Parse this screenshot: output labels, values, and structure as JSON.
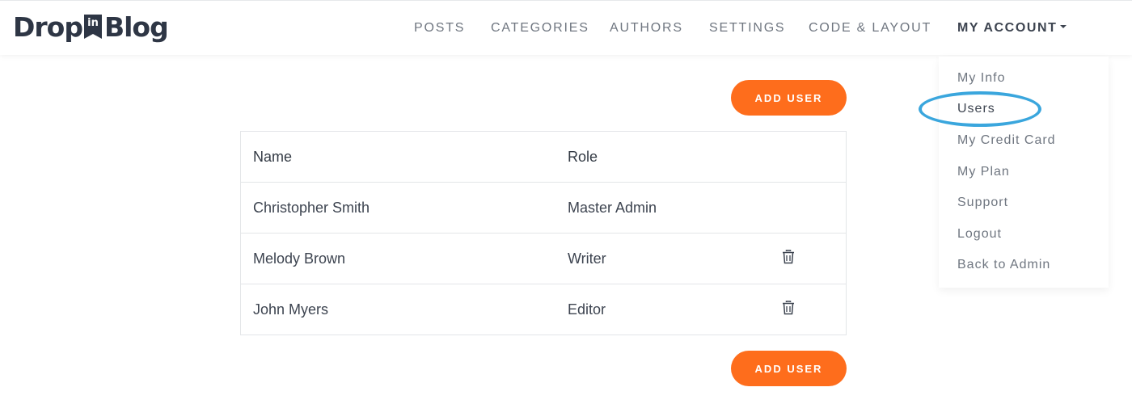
{
  "brand": {
    "part1": "Drop",
    "badge": "in",
    "part2": "Blog"
  },
  "nav": {
    "items": [
      "POSTS",
      "CATEGORIES",
      "AUTHORS",
      "SETTINGS",
      "CODE & LAYOUT"
    ],
    "account": "MY ACCOUNT"
  },
  "account_menu": {
    "items": [
      "My Info",
      "Users",
      "My Credit Card",
      "My Plan",
      "Support",
      "Logout",
      "Back to Admin"
    ],
    "highlighted": "Users"
  },
  "actions": {
    "add_user": "ADD USER"
  },
  "table": {
    "headers": {
      "name": "Name",
      "role": "Role"
    },
    "rows": [
      {
        "name": "Christopher Smith",
        "role": "Master Admin",
        "deletable": false
      },
      {
        "name": "Melody Brown",
        "role": "Writer",
        "deletable": true
      },
      {
        "name": "John Myers",
        "role": "Editor",
        "deletable": true
      }
    ]
  },
  "colors": {
    "accent_orange": "#fe6d1c",
    "highlight_ring": "#3aa6dd",
    "text_dark": "#3d4450",
    "text_muted": "#6f7680"
  },
  "icons": {
    "delete": "trash-icon",
    "dropdown": "caret-down-icon"
  }
}
